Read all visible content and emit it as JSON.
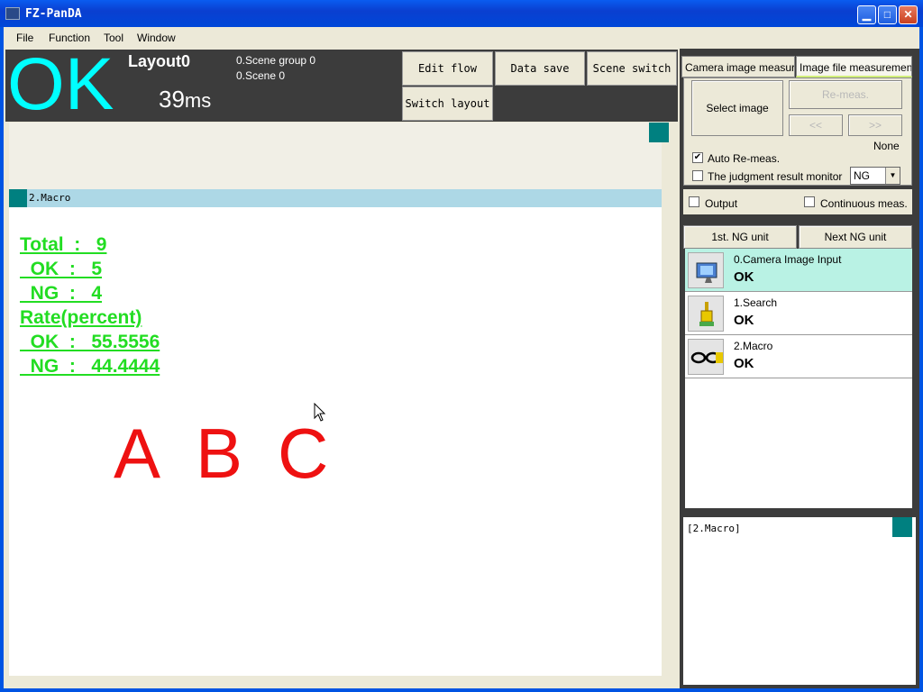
{
  "window": {
    "title": "FZ-PanDA"
  },
  "menu": {
    "items": [
      "File",
      "Function",
      "Tool",
      "Window"
    ]
  },
  "status": {
    "judgment": "OK",
    "layout": "Layout0",
    "time_value": "39",
    "time_unit": "ms",
    "scene_group": "0.Scene group 0",
    "scene": "0.Scene 0"
  },
  "toolbar": {
    "edit_flow": "Edit flow",
    "data_save": "Data save",
    "scene_switch": "Scene switch",
    "switch_layout": "Switch layout"
  },
  "image_panel": {
    "macro_label": "2.Macro",
    "stats": [
      "Total  :   9",
      "  OK  :   5",
      "  NG  :   4",
      "Rate(percent)",
      "  OK  :   55.5556",
      "  NG  :   44.4444"
    ],
    "letters": [
      "A",
      "B",
      "C"
    ]
  },
  "right_panel": {
    "tabs": [
      "Camera image measurement",
      "Image file measurement"
    ],
    "select_image": "Select image",
    "remeas": "Re-meas.",
    "prev": "<<",
    "next": ">>",
    "file_name": "None",
    "auto_remeas": "Auto Re-meas.",
    "judgment_monitor": "The judgment result monitor",
    "judgment_monitor_value": "NG",
    "output": "Output",
    "continuous_meas": "Continuous meas.",
    "first_ng_unit": "1st. NG unit",
    "next_ng_unit": "Next NG unit",
    "units": [
      {
        "name": "0.Camera Image Input",
        "status": "OK",
        "icon": "camera-input-icon"
      },
      {
        "name": "1.Search",
        "status": "OK",
        "icon": "search-unit-icon"
      },
      {
        "name": "2.Macro",
        "status": "OK",
        "icon": "macro-unit-icon"
      }
    ],
    "detail_label": "[2.Macro]"
  },
  "colors": {
    "judgment_ok": "#00ffff",
    "stats_text": "#22dd22",
    "letters": "#ee1111",
    "selected_unit": "#b9f2e4",
    "macro_bar": "#add8e6"
  }
}
